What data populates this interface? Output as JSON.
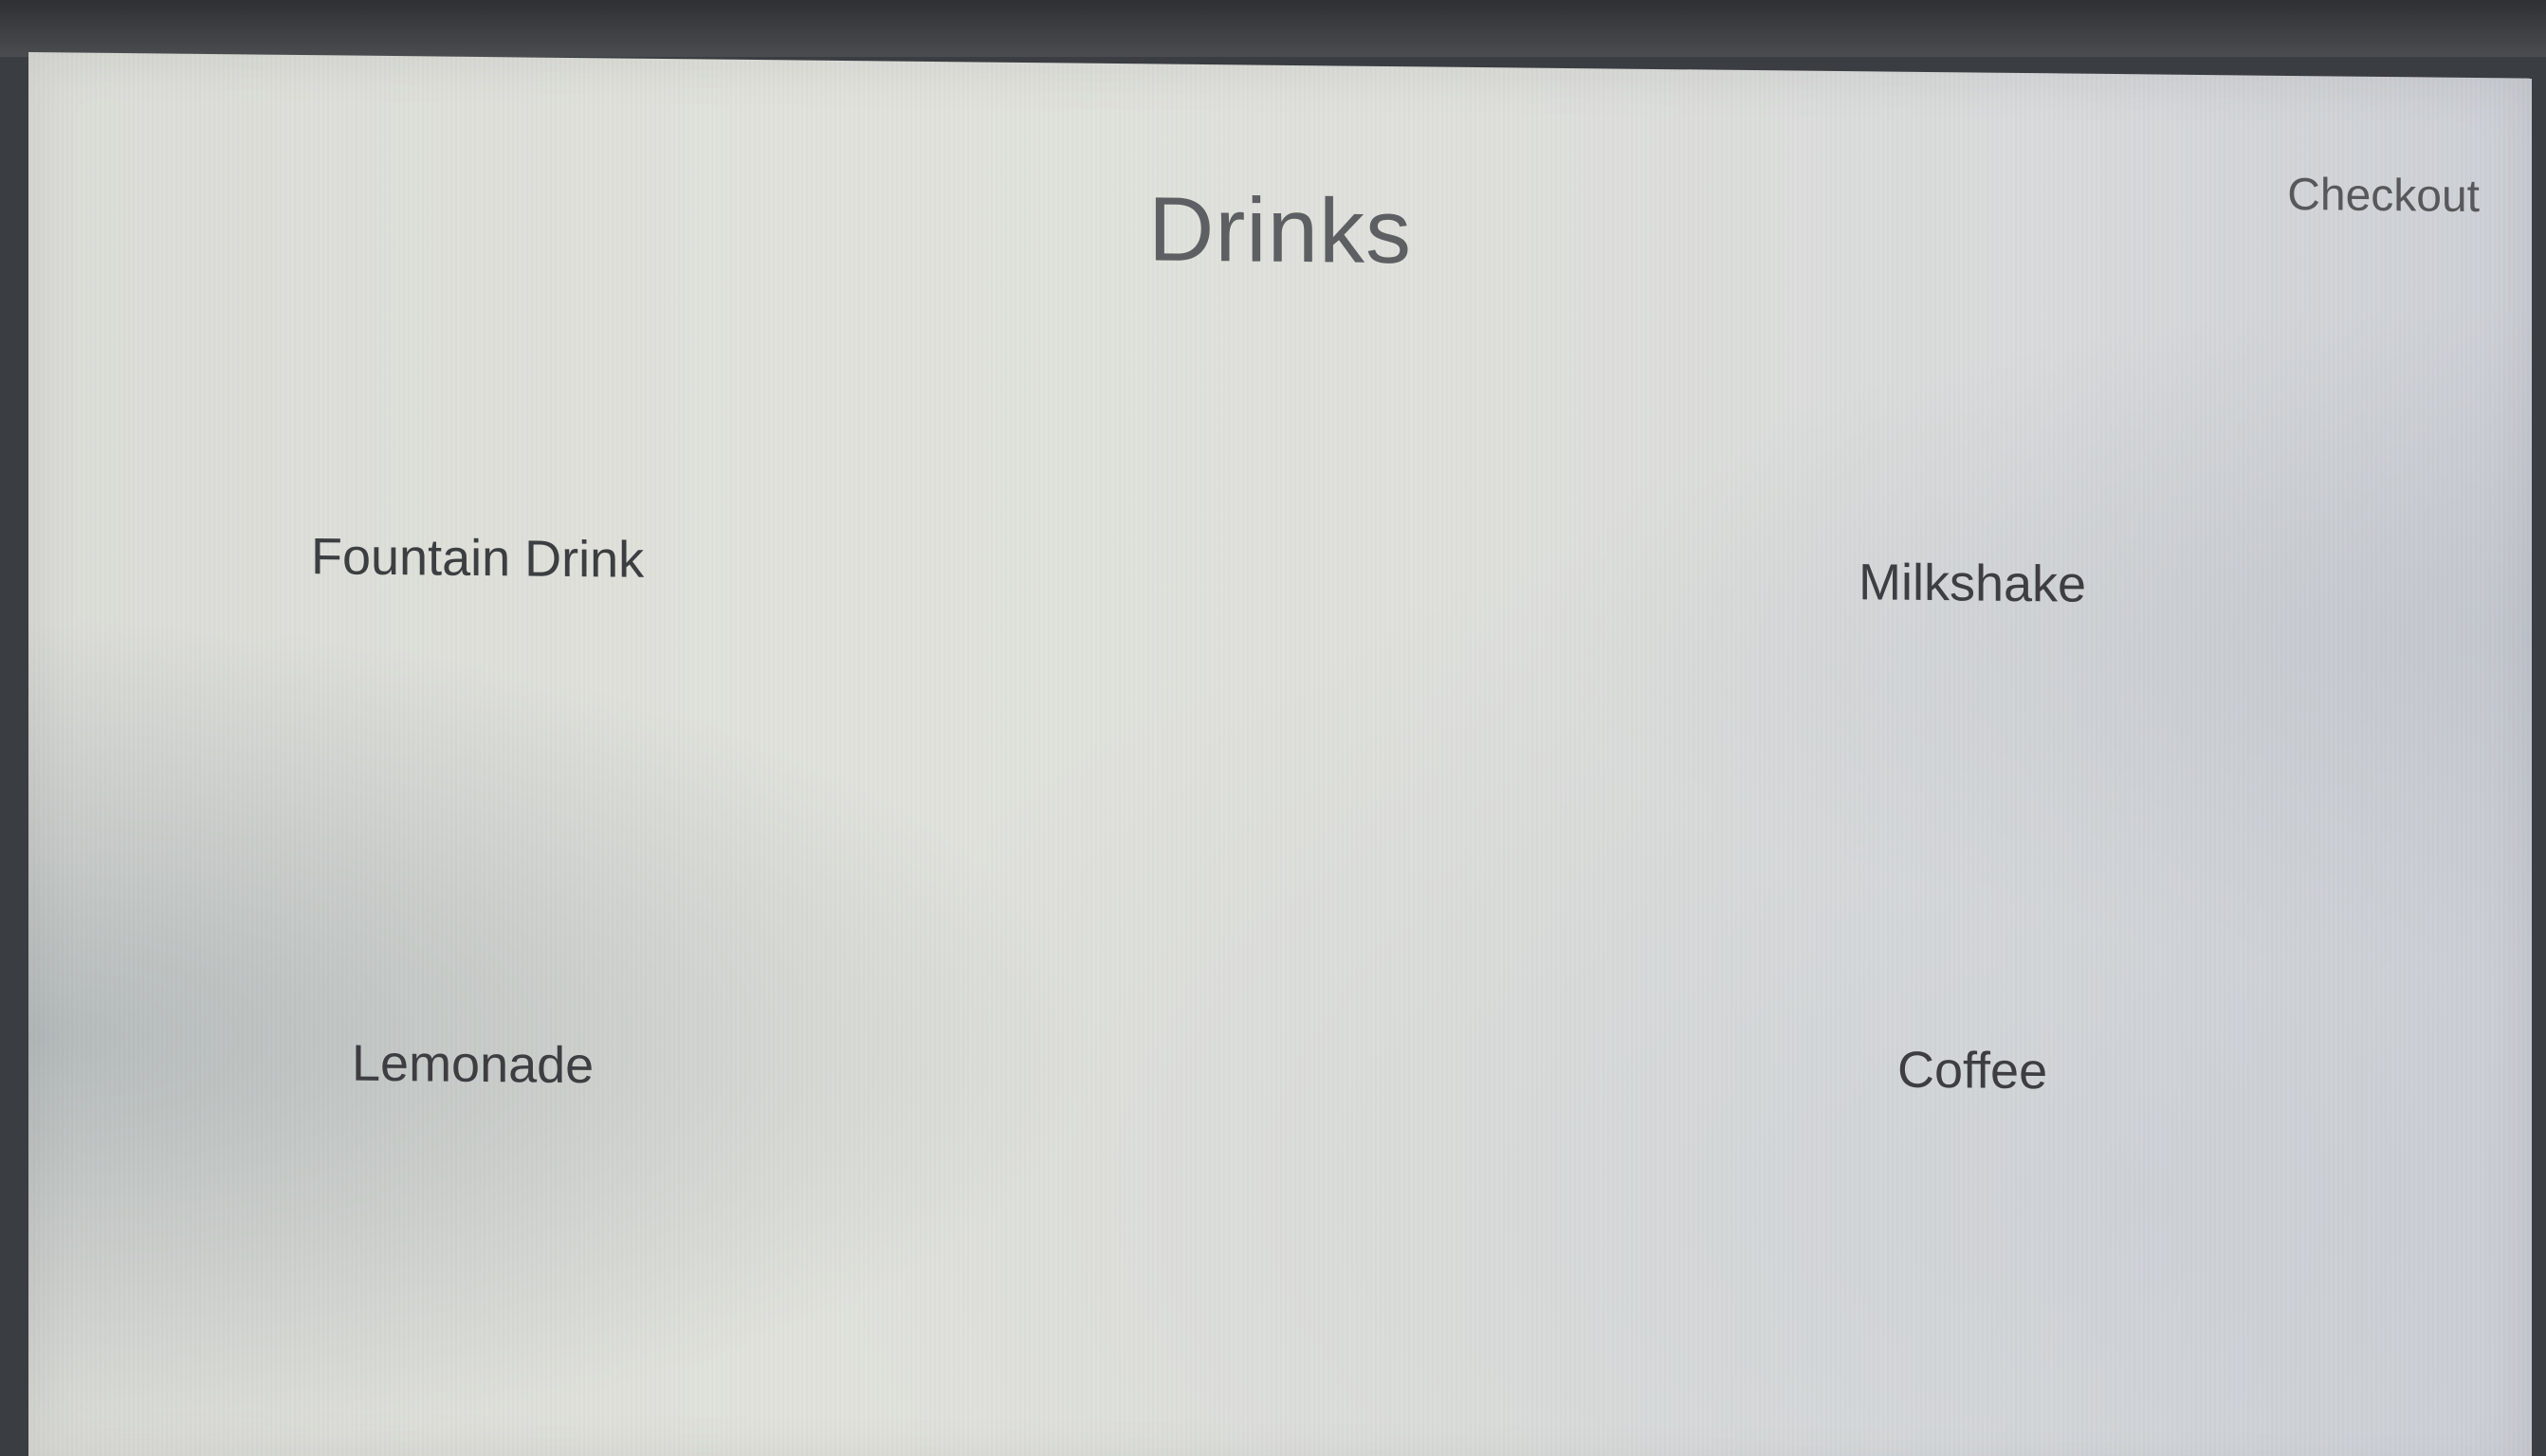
{
  "page": {
    "title": "Drinks",
    "checkout_label": "Checkout"
  },
  "drinks": [
    {
      "label": "Fountain Drink"
    },
    {
      "label": "Milkshake"
    },
    {
      "label": "Lemonade"
    },
    {
      "label": "Coffee"
    }
  ],
  "colors": {
    "background": "#e0e1dc",
    "title_text": "#5d5f62",
    "item_text": "#3c3e41"
  }
}
